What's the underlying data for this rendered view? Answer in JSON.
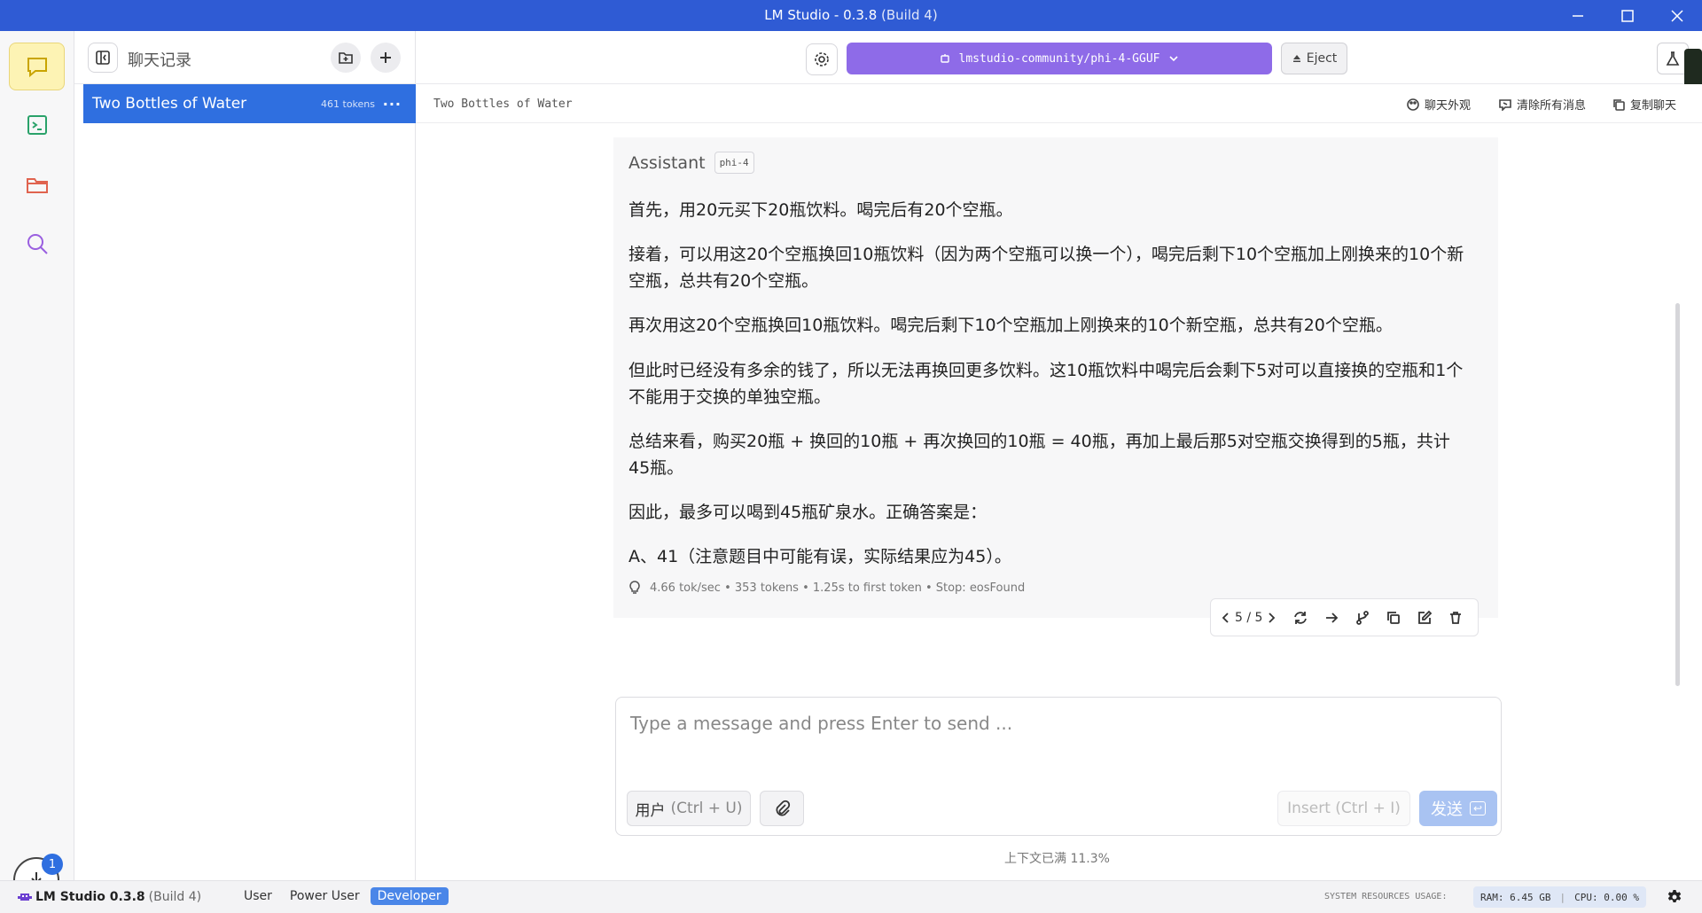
{
  "window": {
    "title": "LM Studio - 0.3.8",
    "build": "(Build 4)"
  },
  "chatlist": {
    "header_title": "聊天记录",
    "chats": [
      {
        "name": "Two Bottles of Water",
        "tokens": "461 tokens"
      }
    ]
  },
  "topbar": {
    "model": "lmstudio-community/phi-4-GGUF",
    "eject_label": "Eject"
  },
  "subbar": {
    "chat_name": "Two Bottles of Water",
    "appearance_label": "聊天外观",
    "clear_label": "清除所有消息",
    "copy_label": "复制聊天"
  },
  "message": {
    "role": "Assistant",
    "model_badge": "phi-4",
    "paragraphs": [
      "首先，用20元买下20瓶饮料。喝完后有20个空瓶。",
      "接着，可以用这20个空瓶换回10瓶饮料（因为两个空瓶可以换一个），喝完后剩下10个空瓶加上刚换来的10个新空瓶，总共有20个空瓶。",
      "再次用这20个空瓶换回10瓶饮料。喝完后剩下10个空瓶加上刚换来的10个新空瓶，总共有20个空瓶。",
      "但此时已经没有多余的钱了，所以无法再换回更多饮料。这10瓶饮料中喝完后会剩下5对可以直接换的空瓶和1个不能用于交换的单独空瓶。",
      "总结来看，购买20瓶 + 换回的10瓶 + 再次换回的10瓶 = 40瓶，再加上最后那5对空瓶交换得到的5瓶，共计45瓶。",
      "因此，最多可以喝到45瓶矿泉水。正确答案是：",
      "A、41（注意题目中可能有误，实际结果应为45）。"
    ],
    "stats": "4.66 tok/sec • 353 tokens • 1.25s to first token • Stop: eosFound",
    "pager": "5 / 5"
  },
  "input": {
    "placeholder": "Type a message and press Enter to send ...",
    "role_label": "用户",
    "role_shortcut": "(Ctrl + U)",
    "insert_label": "Insert",
    "insert_shortcut": "(Ctrl + I)",
    "send_label": "发送",
    "send_key": "↩",
    "context": "上下文已满 11.3%"
  },
  "download_badge": "1",
  "statusbar": {
    "app_name": "LM Studio 0.3.8",
    "build": "(Build 4)",
    "modes": [
      "User",
      "Power User",
      "Developer"
    ],
    "active_mode": "Developer",
    "sysres_label": "SYSTEM RESOURCES USAGE:",
    "ram": "RAM: 6.45 GB",
    "cpu": "CPU: 0.00 %"
  },
  "colors": {
    "titlebar": "#2f5bd4",
    "model_button": "#8e6be8",
    "selected_chat": "#2f6fe0",
    "send_disabled": "#a9c3f2"
  }
}
